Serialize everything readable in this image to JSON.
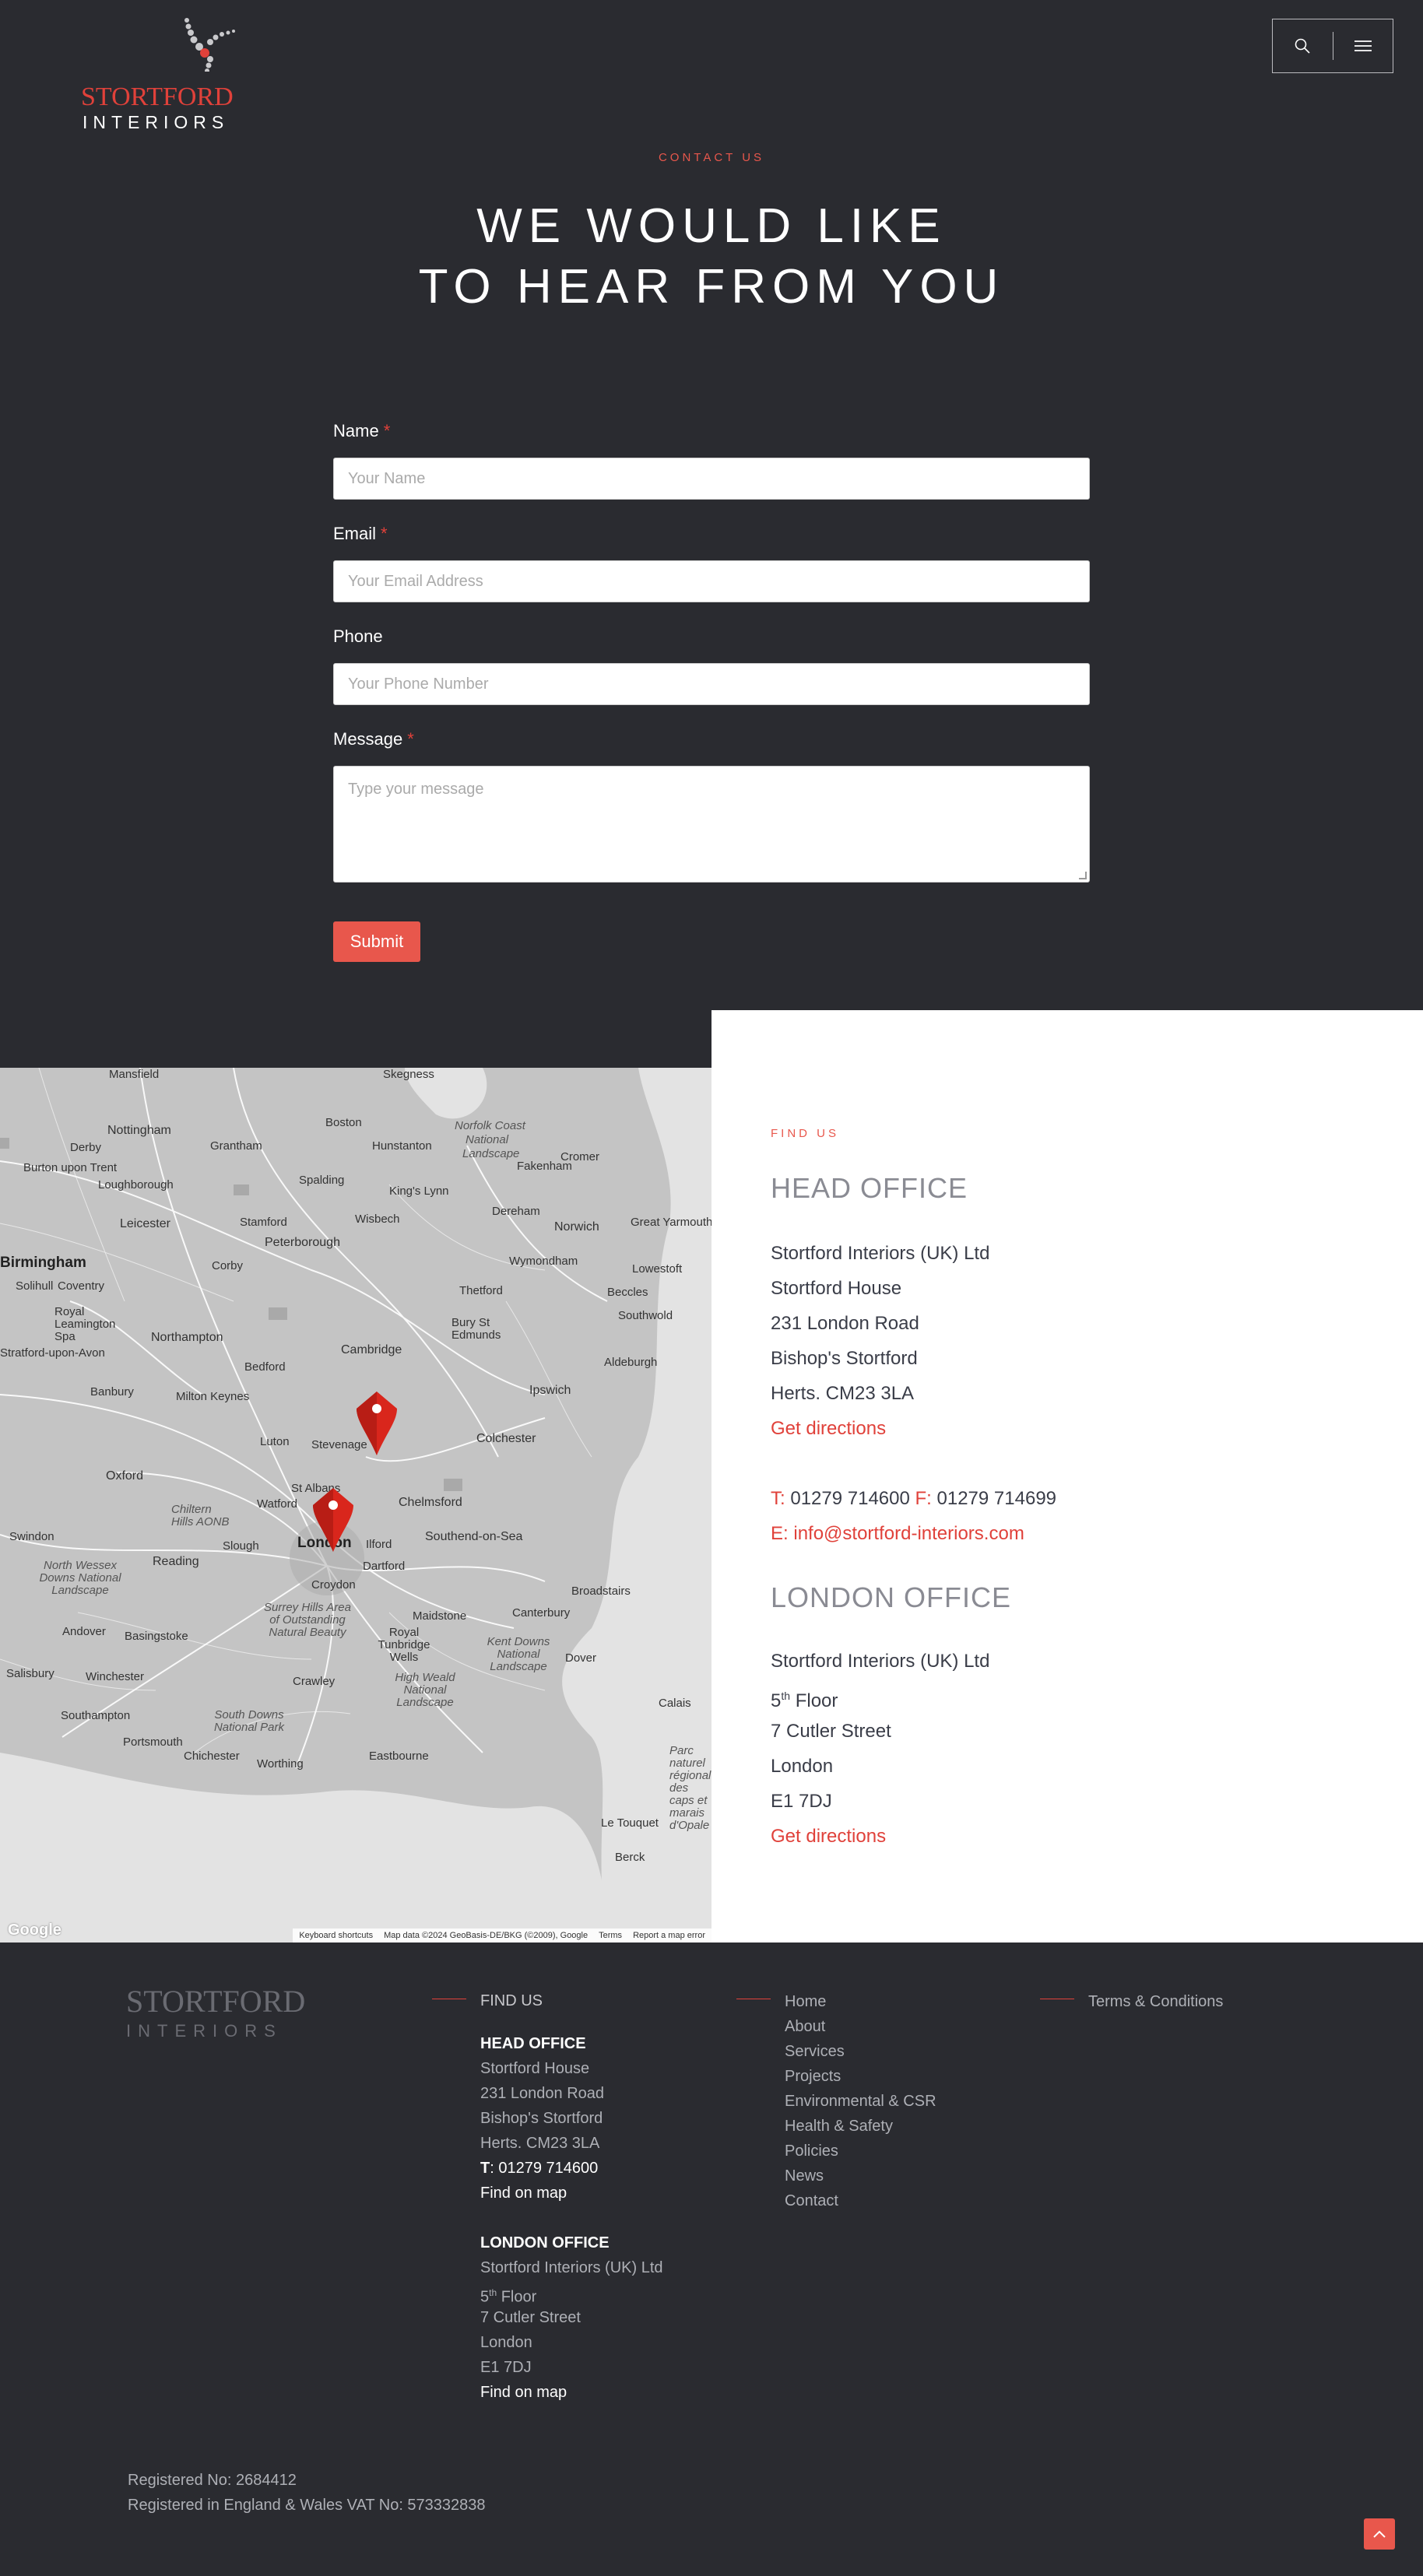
{
  "header": {
    "logo_word1": "STORTFORD",
    "logo_word2": "INTERIORS",
    "search_icon": "search-icon",
    "menu_icon": "hamburger-menu-icon"
  },
  "hero": {
    "eyebrow": "CONTACT US",
    "title_line1": "WE WOULD LIKE",
    "title_line2": "TO HEAR FROM YOU"
  },
  "form": {
    "name_label": "Name",
    "name_placeholder": "Your Name",
    "email_label": "Email",
    "email_placeholder": "Your Email Address",
    "phone_label": "Phone",
    "phone_placeholder": "Your Phone Number",
    "message_label": "Message",
    "message_placeholder": "Type your message",
    "required_mark": "*",
    "submit_label": "Submit"
  },
  "map": {
    "labels": [
      "Mansfield",
      "Skegness",
      "Nottingham",
      "Derby",
      "Boston",
      "Norfolk Coast",
      "National",
      "Landscape",
      "Grantham",
      "Hunstanton",
      "Cromer",
      "Burton upon Trent",
      "Loughborough",
      "Spalding",
      "King's Lynn",
      "Fakenham",
      "Leicester",
      "Stamford",
      "Wisbech",
      "Dereham",
      "Norwich",
      "Great Yarmouth",
      "Peterborough",
      "Corby",
      "Wymondham",
      "Lowestoft",
      "Coventry",
      "Royal Leamington Spa",
      "Northampton",
      "Thetford",
      "Beccles",
      "Southwold",
      "Bury St Edmunds",
      "Cambridge",
      "Aldeburgh",
      "Bedford",
      "Stratford-upon-Avon",
      "Banbury",
      "Milton Keynes",
      "Ipswich",
      "Luton",
      "Colchester",
      "Oxford",
      "Stevenage",
      "Chiltern Hills AONB",
      "St Albans",
      "Watford",
      "Chelmsford",
      "Swindon",
      "Reading",
      "Slough",
      "London",
      "Ilford",
      "Southend-on-Sea",
      "North Wessex Downs National Landscape",
      "Dartford",
      "Croydon",
      "Broadstairs",
      "Andover",
      "Basingstoke",
      "Surrey Hills Area of Outstanding Natural Beauty",
      "Maidstone",
      "Canterbury",
      "Salisbury",
      "Winchester",
      "Royal Tunbridge Wells",
      "Kent Downs National Landscape",
      "Dover",
      "Crawley",
      "High Weald National Landscape",
      "Calais",
      "Southampton",
      "South Downs National Park",
      "Portsmouth",
      "Chichester",
      "Worthing",
      "Eastbourne",
      "Parc naturel régional des caps et marais d'Opale",
      "Le Touquet",
      "Berck",
      "Birmingham",
      "Solihull"
    ],
    "attribution": [
      "Keyboard shortcuts",
      "Map data ©2024 GeoBasis-DE/BKG (©2009), Google",
      "Terms",
      "Report a map error"
    ],
    "google_logo": "Google"
  },
  "findus": {
    "eyebrow": "FIND US",
    "head_office_title": "HEAD OFFICE",
    "head_office": [
      "Stortford Interiors (UK) Ltd",
      "Stortford House",
      "231 London Road",
      "Bishop's Stortford",
      "Herts. CM23 3LA"
    ],
    "directions_label": "Get directions",
    "tel_prefix": "T:",
    "tel": "01279 714600",
    "fax_prefix": "F:",
    "fax": "01279 714699",
    "email_prefix": "E:",
    "email": "info@stortford-interiors.com",
    "london_office_title": "LONDON OFFICE",
    "london_company": "Stortford Interiors (UK) Ltd",
    "london_floor_num": "5",
    "london_floor_sup": "th",
    "london_floor_word": "Floor",
    "london_street": "7 Cutler Street",
    "london_city": "London",
    "london_postcode": "E1 7DJ"
  },
  "footer": {
    "logo_word1": "STORTFORD",
    "logo_word2": "INTERIORS",
    "find_us_head": "FIND US",
    "head_office_label": "HEAD OFFICE",
    "head_office_lines": [
      "Stortford House",
      "231 London Road",
      "Bishop's Stortford",
      "Herts. CM23 3LA"
    ],
    "tel_prefix": "T",
    "tel": ": 01279 714600",
    "find_on_map": "Find on map",
    "london_office_label": "LONDON OFFICE",
    "london_company": "Stortford Interiors (UK) Ltd",
    "london_floor_num": "5",
    "london_floor_sup": "th",
    "london_floor_word": "Floor",
    "london_lines": [
      "7 Cutler Street",
      "London",
      "E1 7DJ"
    ],
    "nav": [
      "Home",
      "About",
      "Services",
      "Projects",
      "Environmental & CSR",
      "Health & Safety",
      "Policies",
      "News",
      "Contact"
    ],
    "terms": "Terms & Conditions",
    "registered_no": "Registered No: 2684412",
    "vat": "Registered in England & Wales VAT No: 573332838"
  },
  "colors": {
    "background": "#2a2b30",
    "accent": "#e8574c",
    "panel": "#ffffff"
  }
}
